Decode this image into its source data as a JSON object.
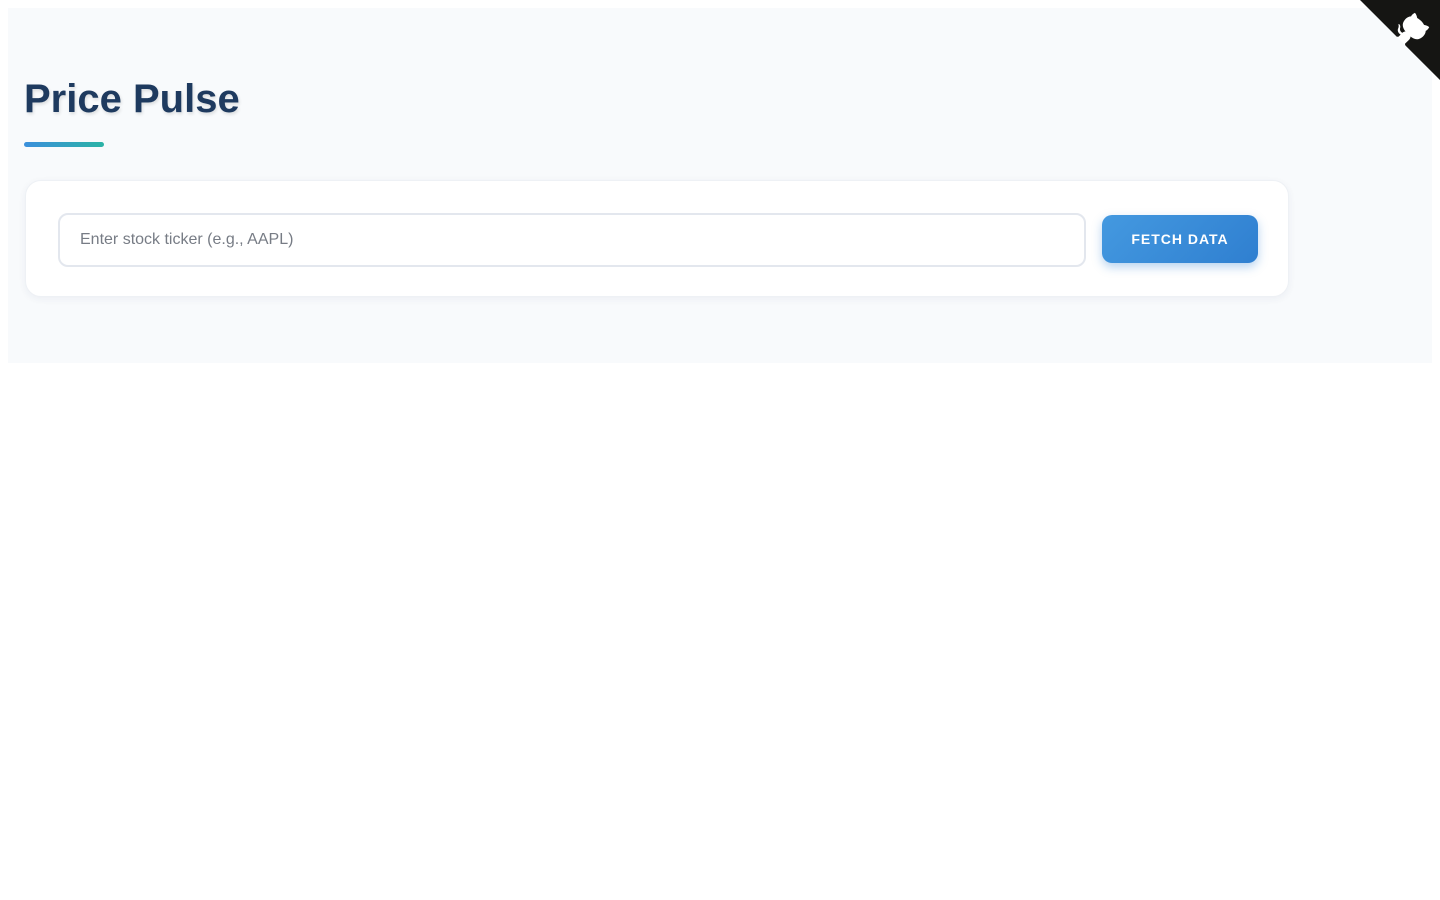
{
  "header": {
    "title": "Price Pulse"
  },
  "search": {
    "placeholder": "Enter stock ticker (e.g., AAPL)",
    "value": "",
    "button_label": "FETCH DATA"
  },
  "corner": {
    "icon": "github-icon",
    "color": "#151513"
  },
  "colors": {
    "title": "#1e3a5f",
    "accent": "#3b8fdc",
    "accent_secondary": "#2bb3a6",
    "background": "#f8fafc"
  }
}
